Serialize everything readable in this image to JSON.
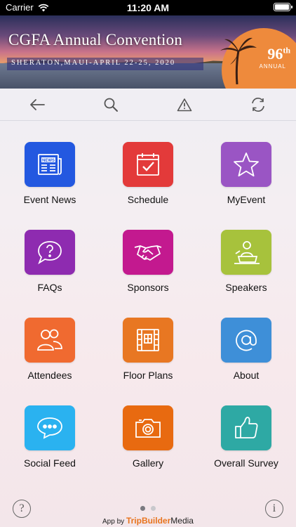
{
  "status_bar": {
    "carrier": "Carrier",
    "time": "11:20 AM"
  },
  "banner": {
    "title": "CGFA Annual Convention",
    "subtitle": "SHERATON,MAUI-APRIL 22-25, 2020",
    "badge_number": "96",
    "badge_suffix": "th",
    "badge_label": "ANNUAL"
  },
  "toolbar": {
    "back_icon": "back-arrow-icon",
    "search_icon": "search-icon",
    "alert_icon": "warning-icon",
    "refresh_icon": "refresh-icon"
  },
  "tiles": [
    {
      "label": "Event News",
      "color": "#2358e0",
      "icon": "newspaper-icon"
    },
    {
      "label": "Schedule",
      "color": "#e33a3a",
      "icon": "calendar-check-icon"
    },
    {
      "label": "MyEvent",
      "color": "#9a55c4",
      "icon": "star-icon"
    },
    {
      "label": "FAQs",
      "color": "#8e2bb0",
      "icon": "question-bubble-icon"
    },
    {
      "label": "Sponsors",
      "color": "#c3198f",
      "icon": "handshake-icon"
    },
    {
      "label": "Speakers",
      "color": "#a7c23c",
      "icon": "speaker-icon"
    },
    {
      "label": "Attendees",
      "color": "#f06a30",
      "icon": "people-icon"
    },
    {
      "label": "Floor Plans",
      "color": "#e87722",
      "icon": "floorplan-icon"
    },
    {
      "label": "About",
      "color": "#3e8fd8",
      "icon": "at-icon"
    },
    {
      "label": "Social Feed",
      "color": "#2ab2f0",
      "icon": "chat-icon"
    },
    {
      "label": "Gallery",
      "color": "#e86a10",
      "icon": "camera-icon"
    },
    {
      "label": "Overall Survey",
      "color": "#2ea9a4",
      "icon": "thumbs-up-icon"
    }
  ],
  "footer": {
    "help": "?",
    "info": "i",
    "app_by": "App by",
    "brand": "TripBuilder",
    "brand_suffix": "Media",
    "pages_total": 2,
    "page_current": 1
  }
}
